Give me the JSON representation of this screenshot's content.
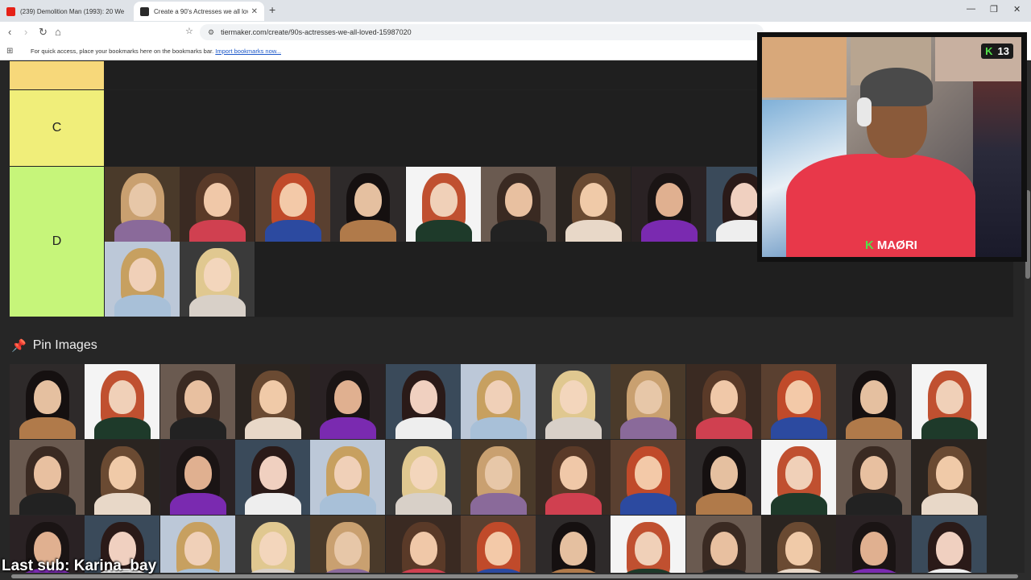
{
  "browser": {
    "tabs": [
      {
        "title": "(239) Demolition Man (1993): 20 We",
        "favicon_color": "#e62117",
        "active": false
      },
      {
        "title": "Create a 90's Actresses we all lov",
        "favicon_color": "#2a2a2a",
        "active": true
      }
    ],
    "url": "tiermaker.com/create/90s-actresses-we-all-loved-15987020",
    "bookmarks_message": "For quick access, place your bookmarks here on the bookmarks bar.",
    "bookmarks_link": "Import bookmarks now..."
  },
  "tiers": [
    {
      "label": "C",
      "color": "#f0ee7a",
      "images": 0
    },
    {
      "label": "D",
      "color": "#c6f57a",
      "images": 11
    }
  ],
  "pin_section": {
    "title": "Pin Images",
    "rows": 3,
    "images_per_row": 13
  },
  "stream_overlay": {
    "kick_viewers": "13",
    "streamer_name": "MAØRI",
    "accent_color": "#54e04a"
  },
  "last_sub": "Last sub: Karina_bay"
}
